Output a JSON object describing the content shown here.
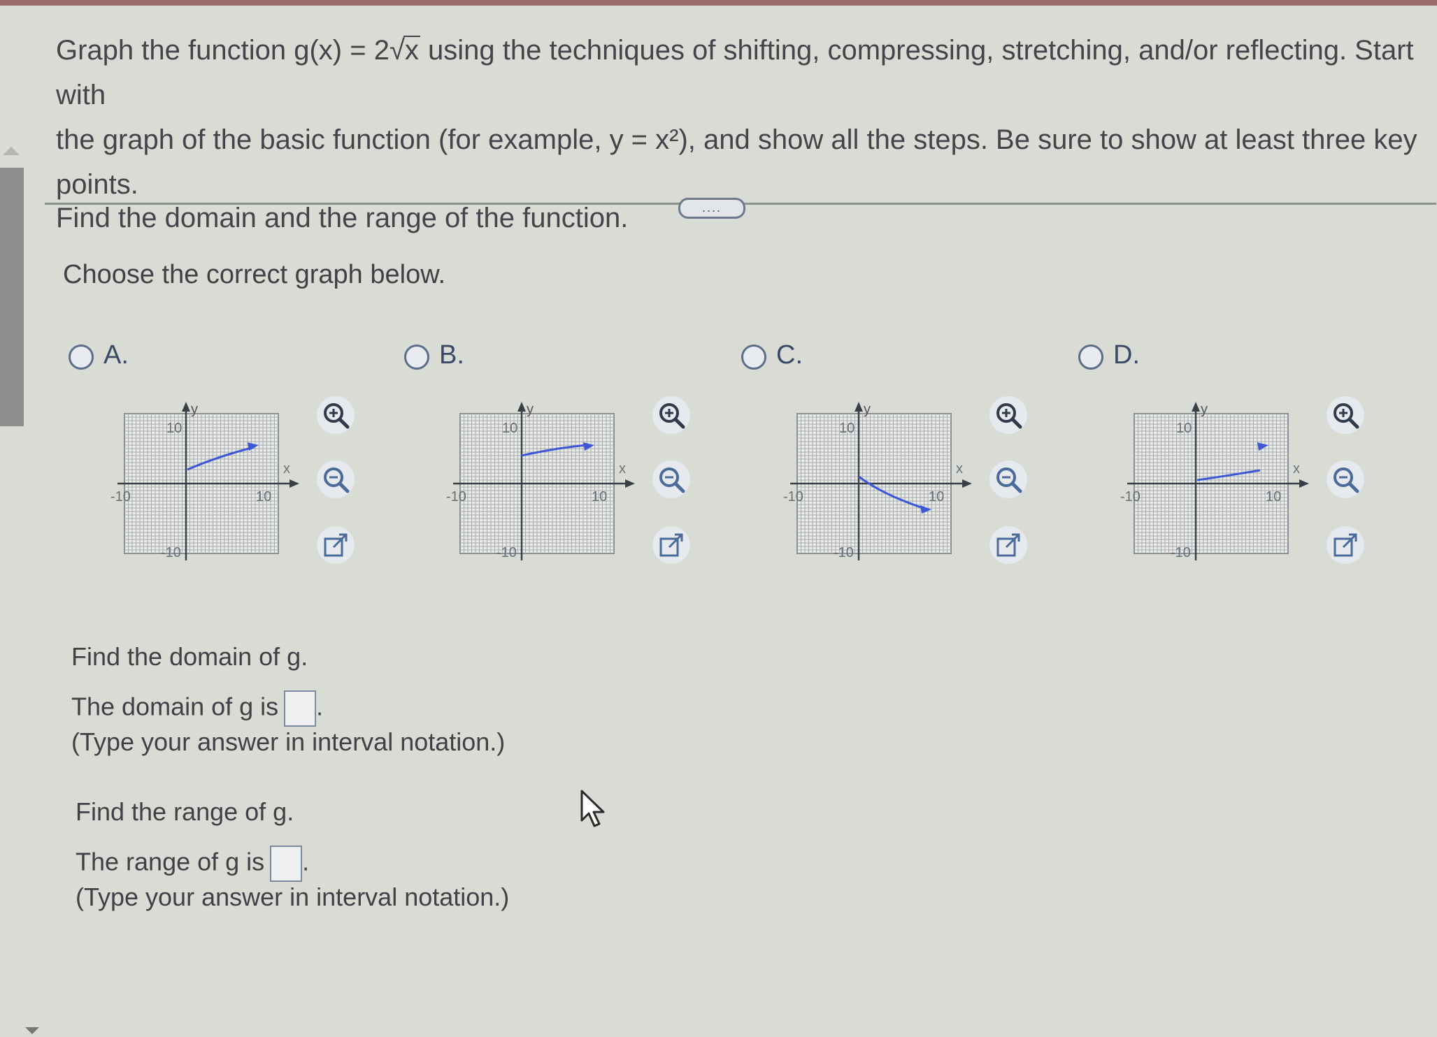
{
  "question": {
    "line1_a": "Graph the function g(x) = 2",
    "line1_rad": "x",
    "line1_b": " using the techniques of shifting, compressing, stretching, and/or reflecting. Start with",
    "line2": "the graph of the basic function (for example, y = x²), and show all the steps. Be sure to show at least three key points.",
    "line3": "Find the domain and the range of the function."
  },
  "more_button": "....",
  "prompt": "Choose the correct graph below.",
  "options": [
    {
      "letter": "A.",
      "ytick": "10",
      "ntick": "-10",
      "xtick": "10",
      "nxtick": "-10",
      "xlabel": "x",
      "ylabel": "y",
      "curve": "up-from-origin-high"
    },
    {
      "letter": "B.",
      "ytick": "10",
      "ntick": "-10",
      "xtick": "10",
      "nxtick": "-10",
      "xlabel": "x",
      "ylabel": "y",
      "curve": "up-shifted"
    },
    {
      "letter": "C.",
      "ytick": "10",
      "ntick": "-10",
      "xtick": "10",
      "nxtick": "-10",
      "xlabel": "x",
      "ylabel": "y",
      "curve": "down-reflected"
    },
    {
      "letter": "D.",
      "ytick": "10",
      "ntick": "-10",
      "xtick": "10",
      "nxtick": "-10",
      "xlabel": "x",
      "ylabel": "y",
      "curve": "up-from-origin-low"
    }
  ],
  "domain": {
    "heading": "Find the domain of g.",
    "text": "The domain of g is",
    "hint": "(Type your answer in interval notation.)"
  },
  "range": {
    "heading": "Find the range of g.",
    "text": "The range of g is",
    "hint": "(Type your answer in interval notation.)"
  },
  "colors": {
    "curve": "#3d57d6",
    "grid": "#9aa0a6",
    "axis": "#3a3f47"
  },
  "icons": [
    "zoom-in-icon",
    "zoom-out-icon",
    "open-new-window-icon",
    "radio-icon",
    "cursor-icon"
  ]
}
